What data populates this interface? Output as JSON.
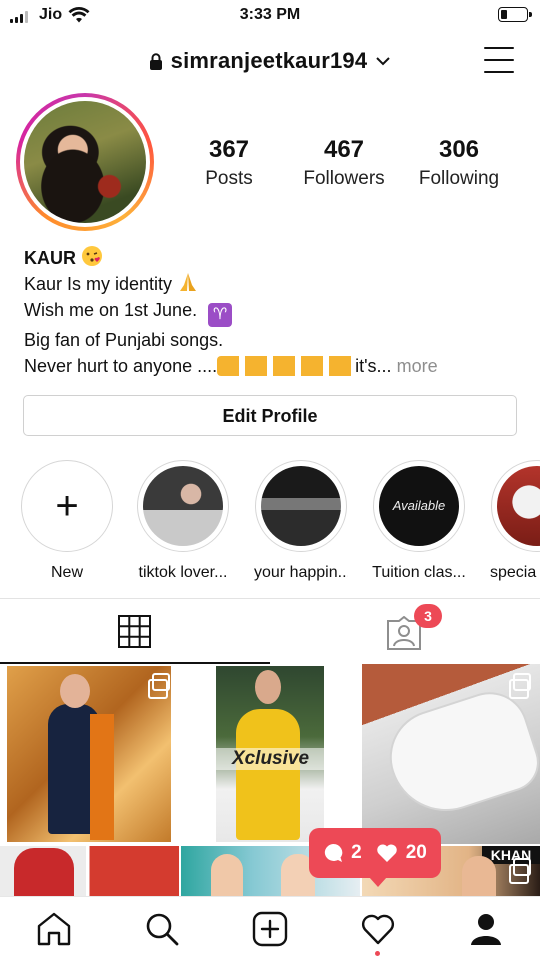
{
  "status_bar": {
    "carrier": "Jio",
    "time": "3:33 PM"
  },
  "header": {
    "username": "simranjeetkaur194"
  },
  "stats": [
    {
      "value": "367",
      "label": "Posts"
    },
    {
      "value": "467",
      "label": "Followers"
    },
    {
      "value": "306",
      "label": "Following"
    }
  ],
  "bio": {
    "name": "KAUR",
    "line1": "Kaur Is my identity",
    "line2": "Wish me on 1st June.",
    "line3": "Big fan of Punjabi songs.",
    "line4": "Never hurt to anyone ....",
    "line4_tail": "it's...",
    "more": "more"
  },
  "edit_profile": "Edit Profile",
  "highlights": [
    {
      "label": "New"
    },
    {
      "label": "tiktok lover..."
    },
    {
      "label": "your happin..."
    },
    {
      "label": "Tuition clas..."
    },
    {
      "label": "specia"
    }
  ],
  "highlight_text": {
    "tuition_card": "Available"
  },
  "tabs": {
    "tagged_badge": "3"
  },
  "posts": {
    "xclusive_label": "Xclusive",
    "banner_text": "KHAN"
  },
  "activity": {
    "comments": "2",
    "likes": "20"
  },
  "colors": {
    "accent_red": "#ed4956",
    "text": "#111111",
    "muted": "#8e8e8e"
  },
  "icons": [
    "home-icon",
    "search-icon",
    "add-post-icon",
    "heart-icon",
    "profile-icon",
    "grid-icon",
    "tagged-icon",
    "lock-icon",
    "menu-icon"
  ]
}
